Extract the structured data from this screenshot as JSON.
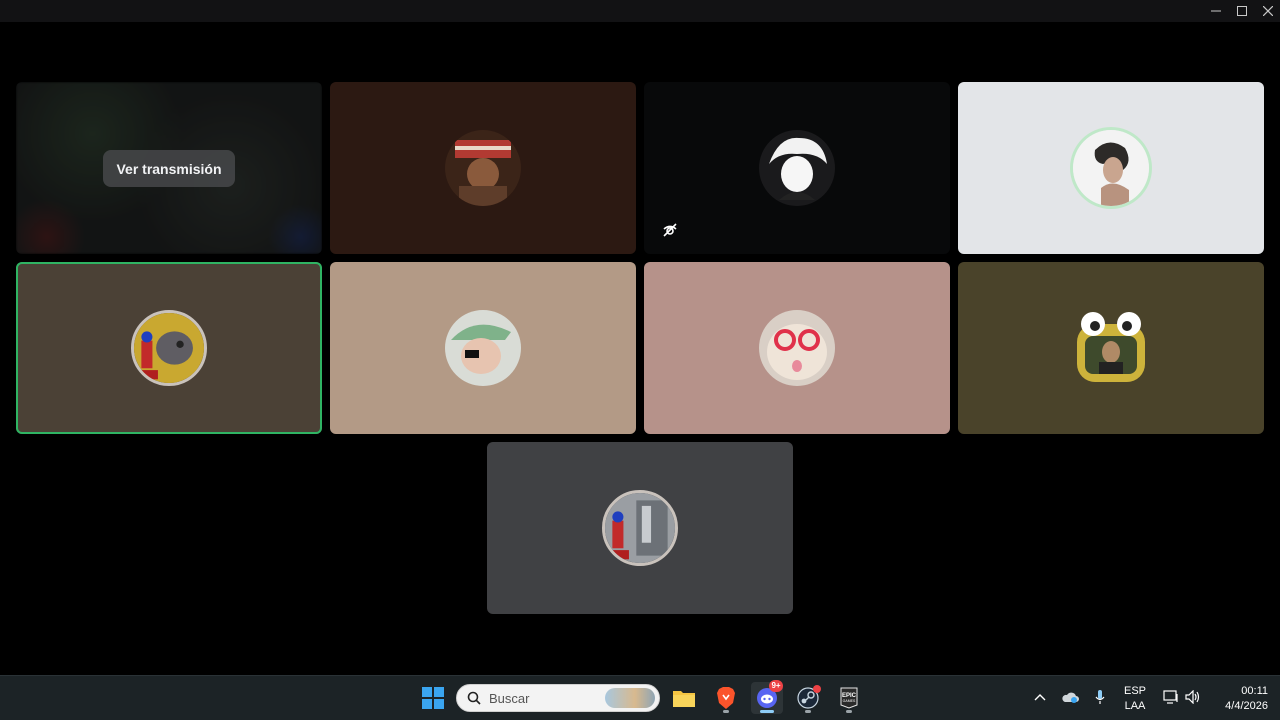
{
  "window": {
    "controls": [
      "minimize-icon",
      "maximize-icon",
      "close-icon"
    ]
  },
  "stream_tile": {
    "watch_label": "Ver transmisión"
  },
  "tiles": [
    {
      "id": "participant-2",
      "bg": "#2c1912"
    },
    {
      "id": "participant-3",
      "bg": "#08090a",
      "video_off": true
    },
    {
      "id": "participant-4",
      "bg": "#e3e5e8"
    },
    {
      "id": "participant-5",
      "bg": "#4b4136",
      "speaking": true
    },
    {
      "id": "participant-6",
      "bg": "#b39a86"
    },
    {
      "id": "participant-7",
      "bg": "#b6928a"
    },
    {
      "id": "participant-8",
      "bg": "#4a432a"
    },
    {
      "id": "participant-9",
      "bg": "#404144"
    }
  ],
  "taskbar": {
    "search_placeholder": "Buscar",
    "apps": [
      "windows-start-icon",
      "file-explorer-icon",
      "brave-browser-icon",
      "discord-icon",
      "steam-icon",
      "epic-games-icon"
    ],
    "discord_badge": "9+",
    "language": "ESP",
    "keyboard": "LAA",
    "time": "00:11",
    "date": "4/4/2026"
  },
  "colors": {
    "speaking_border": "#2fb463",
    "taskbar_bg": "#1c2326",
    "discord_blurple": "#5865f2"
  }
}
